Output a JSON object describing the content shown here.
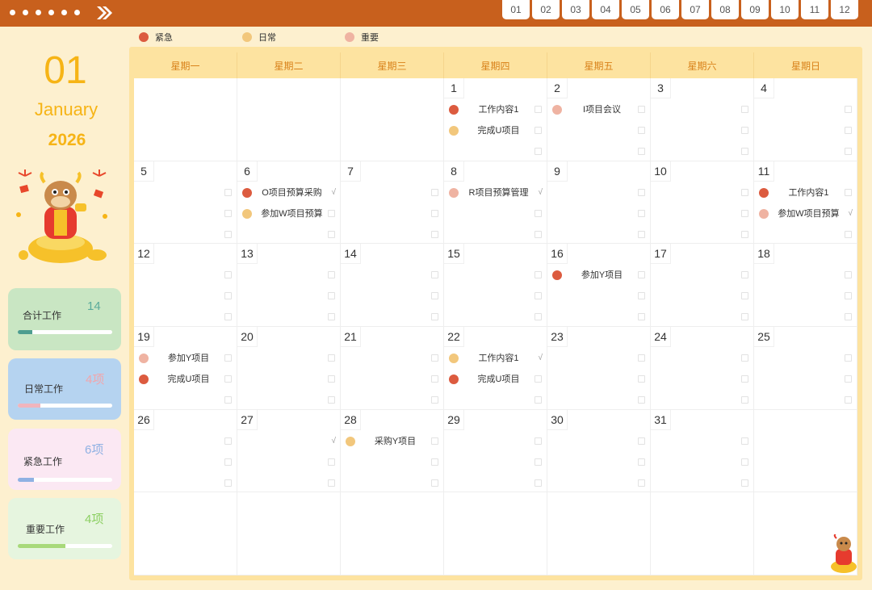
{
  "months": [
    "01",
    "02",
    "03",
    "04",
    "05",
    "06",
    "07",
    "08",
    "09",
    "10",
    "11",
    "12"
  ],
  "legend": [
    {
      "label": "紧急",
      "color": "#dc5b3f"
    },
    {
      "label": "日常",
      "color": "#f2c77c"
    },
    {
      "label": "重要",
      "color": "#efb3a2"
    }
  ],
  "date": {
    "day": "01",
    "month": "January",
    "year": "2026"
  },
  "stats": [
    {
      "label": "合计工作",
      "count": "14",
      "count_color": "#5aab9b",
      "bg": "#c9e6c3",
      "bar": "#4e9d90",
      "fraction": 0.15
    },
    {
      "label": "日常工作",
      "count": "4项",
      "count_color": "#f1a6ac",
      "bg": "#b5d3f0",
      "bar": "#f0b5bd",
      "fraction": 0.24
    },
    {
      "label": "紧急工作",
      "count": "6项",
      "count_color": "#8fb1e3",
      "bg": "#fbe8f3",
      "bar": "#8fb1e3",
      "fraction": 0.17
    },
    {
      "label": "重要工作",
      "count": "4项",
      "count_color": "#8ccf62",
      "bg": "#e6f5df",
      "bar": "#a8d97a",
      "fraction": 0.5
    }
  ],
  "weekdays": [
    "星期一",
    "星期二",
    "星期三",
    "星期四",
    "星期五",
    "星期六",
    "星期日"
  ],
  "days": [
    {
      "n": "",
      "tasks": []
    },
    {
      "n": "",
      "tasks": []
    },
    {
      "n": "",
      "tasks": []
    },
    {
      "n": "1",
      "tasks": [
        {
          "text": "工作内容1",
          "color": "#dc5b3f",
          "slot": 0
        },
        {
          "text": "完成U项目",
          "color": "#f2c77c",
          "slot": 1
        }
      ],
      "checks": []
    },
    {
      "n": "2",
      "tasks": [
        {
          "text": "I项目会议",
          "color": "#efb3a2",
          "slot": 0
        }
      ],
      "checks": []
    },
    {
      "n": "3",
      "tasks": []
    },
    {
      "n": "4",
      "tasks": []
    },
    {
      "n": "5",
      "tasks": []
    },
    {
      "n": "6",
      "tasks": [
        {
          "text": "O项目预算采购",
          "color": "#dc5b3f",
          "slot": 0
        },
        {
          "text": "参加W项目预算",
          "color": "#f2c77c",
          "slot": 1
        }
      ],
      "checks": [
        0
      ]
    },
    {
      "n": "7",
      "tasks": []
    },
    {
      "n": "8",
      "tasks": [
        {
          "text": "R项目预算管理",
          "color": "#efb3a2",
          "slot": 0
        }
      ],
      "checks": [
        0
      ]
    },
    {
      "n": "9",
      "tasks": []
    },
    {
      "n": "10",
      "tasks": []
    },
    {
      "n": "11",
      "tasks": [
        {
          "text": "工作内容1",
          "color": "#dc5b3f",
          "slot": 0
        },
        {
          "text": "参加W项目预算",
          "color": "#efb3a2",
          "slot": 1
        }
      ],
      "checks": [
        1
      ]
    },
    {
      "n": "12",
      "tasks": []
    },
    {
      "n": "13",
      "tasks": []
    },
    {
      "n": "14",
      "tasks": []
    },
    {
      "n": "15",
      "tasks": []
    },
    {
      "n": "16",
      "tasks": [
        {
          "text": "参加Y项目",
          "color": "#dc5b3f",
          "slot": 0
        }
      ]
    },
    {
      "n": "17",
      "tasks": []
    },
    {
      "n": "18",
      "tasks": []
    },
    {
      "n": "19",
      "tasks": [
        {
          "text": "参加Y项目",
          "color": "#efb3a2",
          "slot": 0
        },
        {
          "text": "完成U项目",
          "color": "#dc5b3f",
          "slot": 1
        }
      ]
    },
    {
      "n": "20",
      "tasks": []
    },
    {
      "n": "21",
      "tasks": []
    },
    {
      "n": "22",
      "tasks": [
        {
          "text": "工作内容1",
          "color": "#f2c77c",
          "slot": 0
        },
        {
          "text": "完成U项目",
          "color": "#dc5b3f",
          "slot": 1
        }
      ],
      "checks": [
        0
      ]
    },
    {
      "n": "23",
      "tasks": []
    },
    {
      "n": "24",
      "tasks": []
    },
    {
      "n": "25",
      "tasks": []
    },
    {
      "n": "26",
      "tasks": []
    },
    {
      "n": "27",
      "tasks": [],
      "checks": [
        0
      ]
    },
    {
      "n": "28",
      "tasks": [
        {
          "text": "采购Y项目",
          "color": "#f2c77c",
          "slot": 0
        }
      ]
    },
    {
      "n": "29",
      "tasks": []
    },
    {
      "n": "30",
      "tasks": []
    },
    {
      "n": "31",
      "tasks": []
    },
    {
      "n": "",
      "tasks": []
    },
    {
      "n": "",
      "tasks": []
    },
    {
      "n": "",
      "tasks": []
    },
    {
      "n": "",
      "tasks": []
    },
    {
      "n": "",
      "tasks": []
    },
    {
      "n": "",
      "tasks": []
    },
    {
      "n": "",
      "tasks": []
    },
    {
      "n": "",
      "tasks": []
    }
  ],
  "check_mark": "√"
}
